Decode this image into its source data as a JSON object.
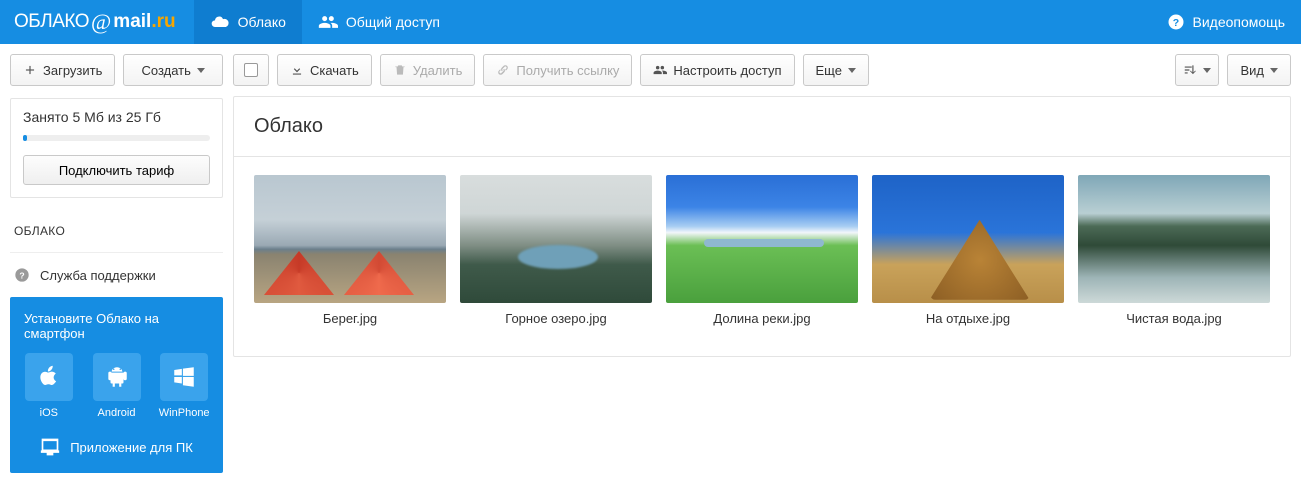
{
  "header": {
    "logo_part1": "ОБЛАКО",
    "logo_mail": "mail",
    "logo_ru": ".ru",
    "nav": [
      {
        "label": "Облако",
        "active": true
      },
      {
        "label": "Общий доступ",
        "active": false
      }
    ],
    "help": "Видеопомощь"
  },
  "sidebar": {
    "upload": "Загрузить",
    "create": "Создать",
    "storage_text": "Занято 5 Мб из 25 Гб",
    "tariff": "Подключить тариф",
    "section_title": "ОБЛАКО",
    "support": "Служба поддержки",
    "promo": {
      "title": "Установите Облако на смартфон",
      "apps": [
        {
          "label": "iOS"
        },
        {
          "label": "Android"
        },
        {
          "label": "WinPhone"
        }
      ],
      "pc": "Приложение для ПК"
    }
  },
  "toolbar": {
    "download": "Скачать",
    "delete": "Удалить",
    "getlink": "Получить ссылку",
    "share": "Настроить доступ",
    "more": "Еще",
    "view": "Вид"
  },
  "content": {
    "title": "Облако",
    "files": [
      {
        "name": "Берег.jpg"
      },
      {
        "name": "Горное озеро.jpg"
      },
      {
        "name": "Долина реки.jpg"
      },
      {
        "name": "На отдыхе.jpg"
      },
      {
        "name": "Чистая вода.jpg"
      }
    ]
  }
}
